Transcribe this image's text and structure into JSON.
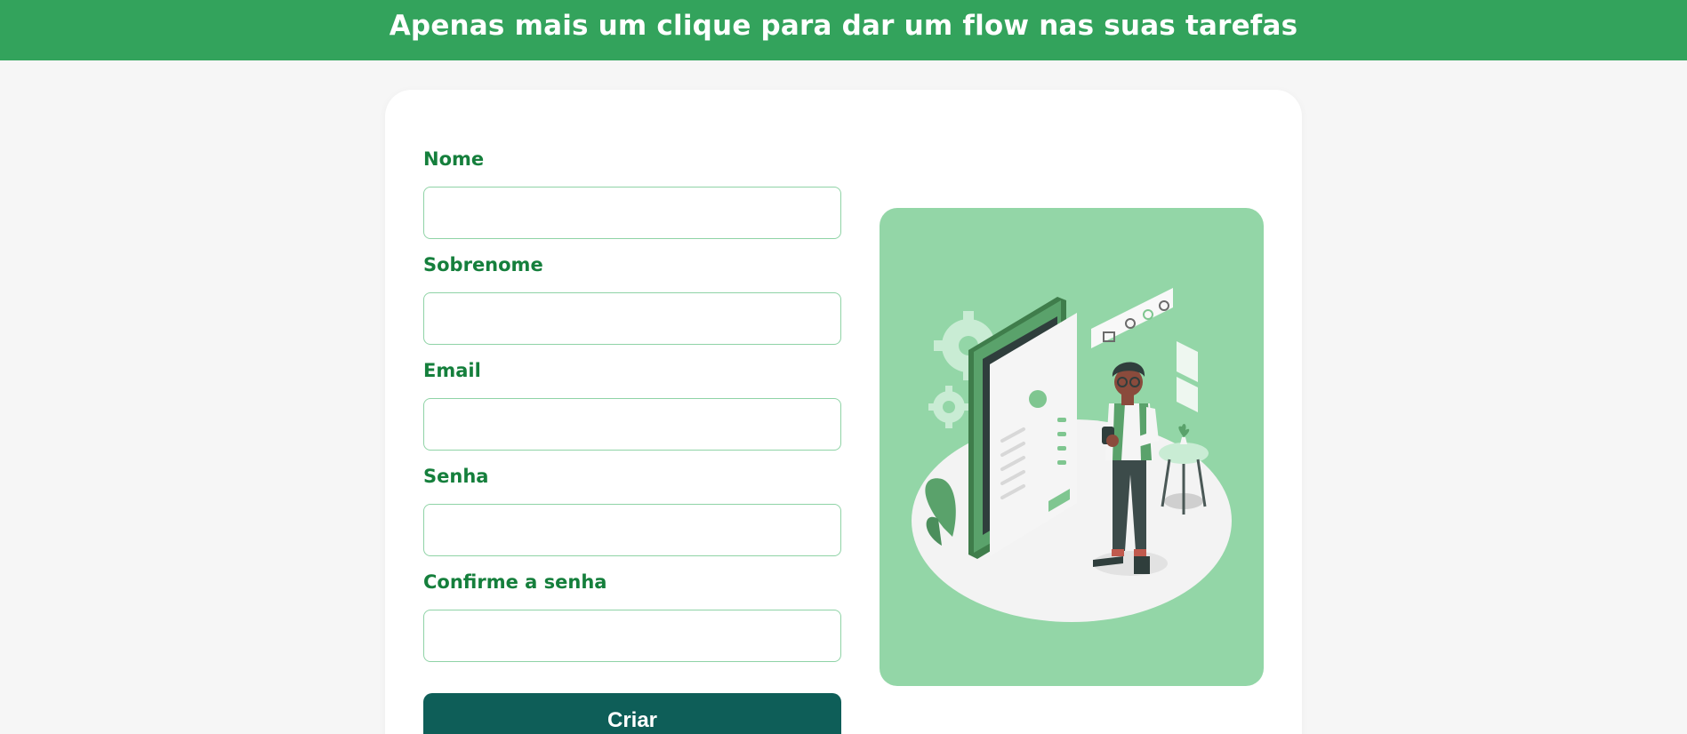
{
  "header": {
    "title": "Apenas mais um clique para dar um flow nas suas tarefas"
  },
  "form": {
    "fields": [
      {
        "label": "Nome",
        "value": "",
        "placeholder": ""
      },
      {
        "label": "Sobrenome",
        "value": "",
        "placeholder": ""
      },
      {
        "label": "Email",
        "value": "",
        "placeholder": ""
      },
      {
        "label": "Senha",
        "value": "",
        "placeholder": ""
      },
      {
        "label": "Confirme a senha",
        "value": "",
        "placeholder": ""
      }
    ],
    "submit_label": "Criar"
  },
  "illustration": {
    "icon": "person-with-phone-settings-illustration"
  },
  "colors": {
    "banner": "#33a35c",
    "label": "#157f3c",
    "input_border": "#8fd3a6",
    "button": "#0e5e58",
    "illustration_bg": "#93d6a7",
    "page_bg": "#f6f6f6"
  }
}
